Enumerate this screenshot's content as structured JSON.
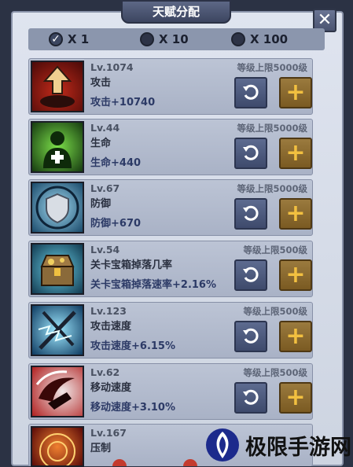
{
  "panel": {
    "title": "天赋分配",
    "close_label": "✕"
  },
  "multiplier": {
    "options": [
      {
        "label": "X 1",
        "checked": true
      },
      {
        "label": "X 10",
        "checked": false
      },
      {
        "label": "X 100",
        "checked": false
      }
    ]
  },
  "talents": [
    {
      "level": "Lv.1074",
      "name": "攻击",
      "bonus": "攻击+10740",
      "cap": "等级上限5000级",
      "icon": "attack-icon"
    },
    {
      "level": "Lv.44",
      "name": "生命",
      "bonus": "生命+440",
      "cap": "等级上限5000级",
      "icon": "health-icon"
    },
    {
      "level": "Lv.67",
      "name": "防御",
      "bonus": "防御+670",
      "cap": "等级上限5000级",
      "icon": "shield-icon"
    },
    {
      "level": "Lv.54",
      "name": "关卡宝箱掉落几率",
      "bonus": "关卡宝箱掉落速率+2.16%",
      "cap": "等级上限500级",
      "icon": "treasure-chest-icon"
    },
    {
      "level": "Lv.123",
      "name": "攻击速度",
      "bonus": "攻击速度+6.15%",
      "cap": "等级上限500级",
      "icon": "lightning-sword-icon"
    },
    {
      "level": "Lv.62",
      "name": "移动速度",
      "bonus": "移动速度+3.10%",
      "cap": "等级上限500级",
      "icon": "dash-icon"
    },
    {
      "level": "Lv.167",
      "name": "压制",
      "bonus": "",
      "cap": "",
      "icon": "suppress-icon"
    }
  ],
  "watermark": {
    "text": "极限手游网"
  }
}
